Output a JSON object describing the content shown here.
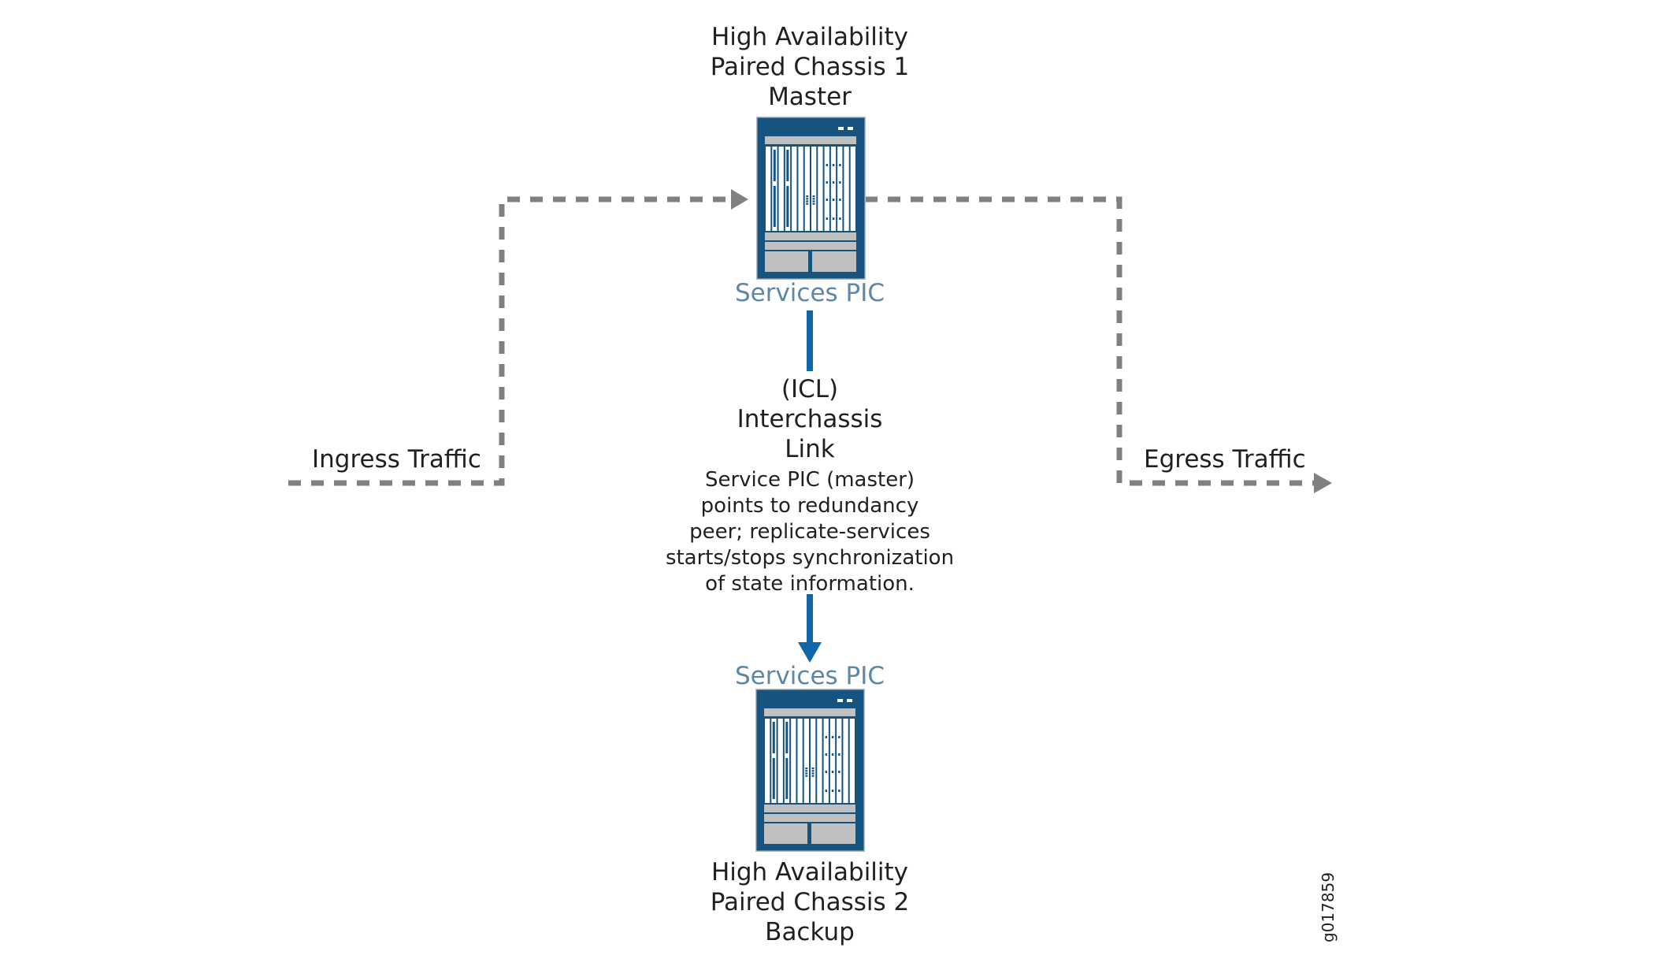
{
  "diagram": {
    "chassis_master": {
      "title_lines": [
        "High Availability",
        "Paired Chassis 1",
        "Master"
      ],
      "pic_label": "Services PIC",
      "icon": "router-chassis-icon"
    },
    "chassis_backup": {
      "title_lines": [
        "High Availability",
        "Paired Chassis 2",
        "Backup"
      ],
      "pic_label": "Services PIC",
      "icon": "router-chassis-icon"
    },
    "icl": {
      "label_lines": [
        "(ICL)",
        "Interchassis",
        "Link"
      ],
      "description_lines": [
        "Service PIC (master)",
        "points to redundancy",
        "peer; replicate-services",
        "starts/stops synchronization",
        "of state information."
      ]
    },
    "ingress_label": "Ingress Traffic",
    "egress_label": "Egress Traffic",
    "figure_id": "g017859",
    "colors": {
      "chassis_body": "#16537e",
      "chassis_panel": "#c0c0c0",
      "icl_link": "#1066a8",
      "pic_label": "#5c87a6",
      "traffic_path": "#808080",
      "text": "#231f20"
    }
  }
}
